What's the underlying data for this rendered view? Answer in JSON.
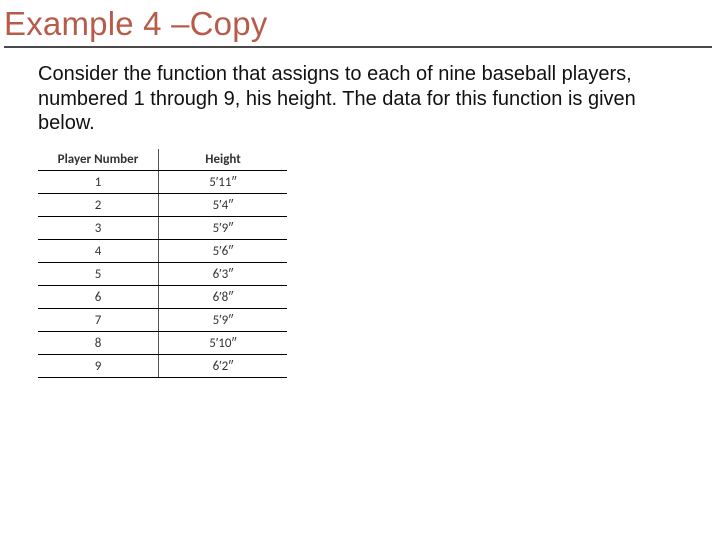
{
  "title": "Example 4 –Copy",
  "body": "Consider the function that assigns to each of nine baseball players, numbered 1 through 9, his height.  The data for this function is given below.",
  "table": {
    "headers": {
      "player": "Player Number",
      "height": "Height"
    },
    "rows": [
      {
        "player": "1",
        "height": "5′11″"
      },
      {
        "player": "2",
        "height": "5′4″"
      },
      {
        "player": "3",
        "height": "5′9″"
      },
      {
        "player": "4",
        "height": "5′6″"
      },
      {
        "player": "5",
        "height": "6′3″"
      },
      {
        "player": "6",
        "height": "6′8″"
      },
      {
        "player": "7",
        "height": "5′9″"
      },
      {
        "player": "8",
        "height": "5′10″"
      },
      {
        "player": "9",
        "height": "6′2″"
      }
    ]
  }
}
